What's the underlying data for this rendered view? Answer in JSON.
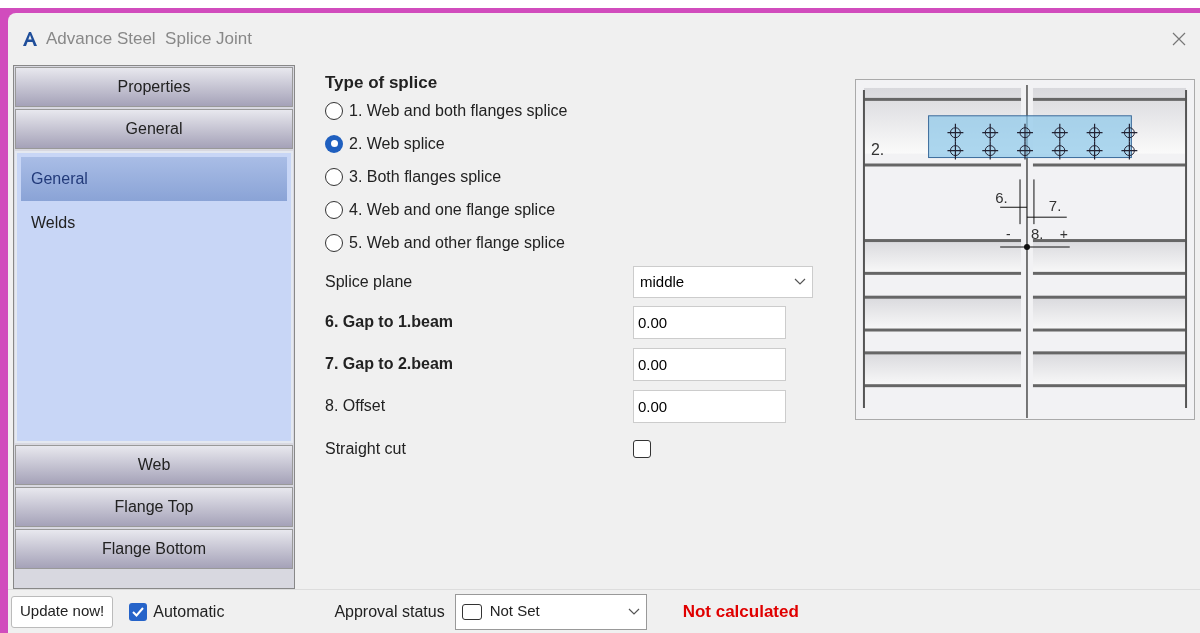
{
  "window": {
    "app": "Advance Steel",
    "title": "Splice Joint"
  },
  "sidebar": {
    "sections": [
      {
        "label": "Properties"
      },
      {
        "label": "General",
        "items": [
          {
            "label": "General",
            "selected": true
          },
          {
            "label": "Welds",
            "selected": false
          }
        ]
      },
      {
        "label": "Web"
      },
      {
        "label": "Flange Top"
      },
      {
        "label": "Flange Bottom"
      }
    ]
  },
  "splice_type": {
    "heading": "Type of splice",
    "options": [
      {
        "label": "1. Web and both flanges splice",
        "selected": false
      },
      {
        "label": "2. Web splice",
        "selected": true
      },
      {
        "label": "3. Both flanges splice",
        "selected": false
      },
      {
        "label": "4. Web and one flange splice",
        "selected": false
      },
      {
        "label": "5. Web and other flange splice",
        "selected": false
      }
    ]
  },
  "fields": [
    {
      "kind": "dropdown",
      "label": "Splice plane",
      "bold": false,
      "value": "middle"
    },
    {
      "kind": "input",
      "label": "6. Gap to 1.beam",
      "bold": true,
      "value": "0.00"
    },
    {
      "kind": "input",
      "label": "7. Gap to 2.beam",
      "bold": true,
      "value": "0.00"
    },
    {
      "kind": "input",
      "label": "8. Offset",
      "bold": false,
      "value": "0.00"
    },
    {
      "kind": "checkbox",
      "label": "Straight cut",
      "bold": false,
      "checked": false
    }
  ],
  "diagram": {
    "labels": [
      "2.",
      "6.",
      "7.",
      "-",
      "8.",
      "+"
    ]
  },
  "bottom_bar": {
    "update_button": "Update now!",
    "automatic": {
      "label": "Automatic",
      "checked": true
    },
    "approval": {
      "label": "Approval status",
      "value": "Not Set"
    },
    "status": "Not calculated"
  }
}
